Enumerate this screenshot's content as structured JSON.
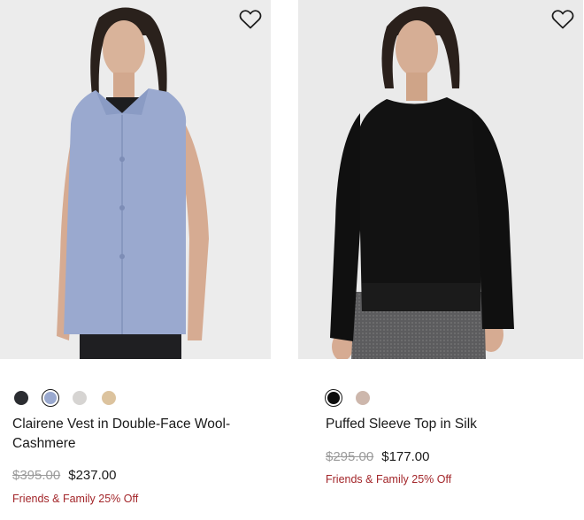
{
  "products": [
    {
      "name": "Clairene Vest in Double-Face Wool-Cashmere",
      "original_price": "$395.00",
      "sale_price": "$237.00",
      "promo": "Friends & Family 25% Off",
      "wishlist_icon": "heart-outline-icon",
      "swatches": [
        {
          "color": "#2b2d31",
          "selected": false
        },
        {
          "color": "#9aa9cf",
          "selected": true
        },
        {
          "color": "#d6d4d2",
          "selected": false
        },
        {
          "color": "#dcc39e",
          "selected": false
        }
      ]
    },
    {
      "name": "Puffed Sleeve Top in Silk",
      "original_price": "$295.00",
      "sale_price": "$177.00",
      "promo": "Friends & Family 25% Off",
      "wishlist_icon": "heart-outline-icon",
      "swatches": [
        {
          "color": "#0d0d0d",
          "selected": true
        },
        {
          "color": "#cdb7ac",
          "selected": false
        }
      ]
    }
  ],
  "colors": {
    "promo": "#a3262a",
    "strike_price": "#9a9a9a",
    "text": "#1a1a1a"
  }
}
